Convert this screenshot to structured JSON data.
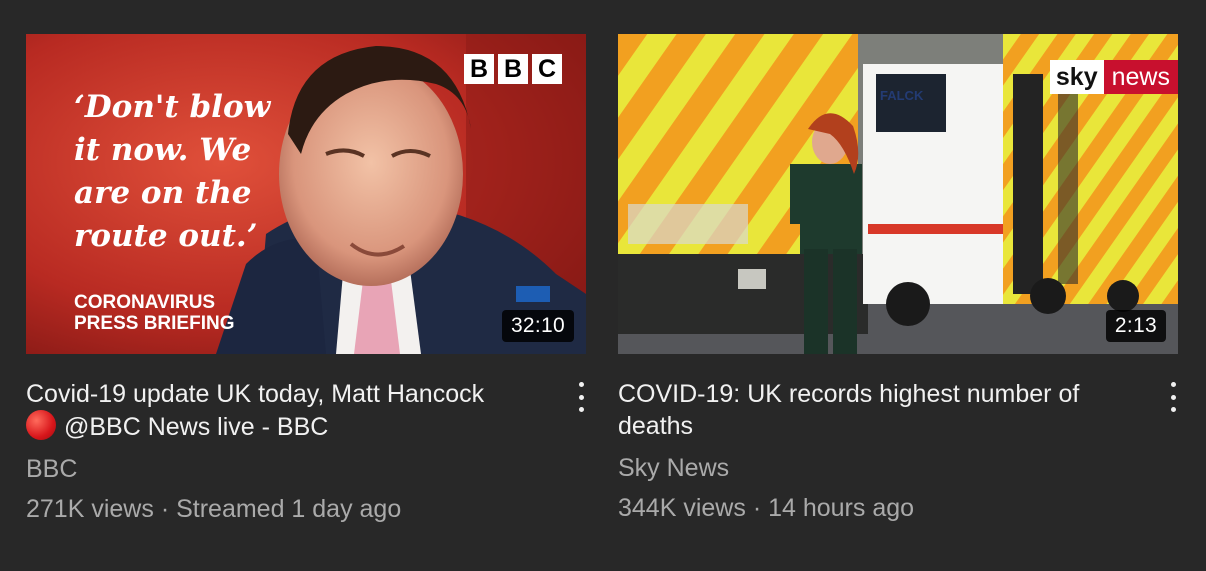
{
  "videos": [
    {
      "title": "Covid-19 update UK today, Matt Hancock",
      "title_line2": "@BBC News live - BBC",
      "channel": "BBC",
      "views": "271K views",
      "separator": "·",
      "age": "Streamed 1 day ago",
      "duration": "32:10",
      "thumb_quote": "‘Don't blow\nit now. We\nare on the\nroute out.’",
      "thumb_briefing_line1": "CORONAVIRUS",
      "thumb_briefing_line2": "PRESS BRIEFING",
      "thumb_logo": [
        "B",
        "B",
        "C"
      ],
      "menu_icon": "more-vert-icon"
    },
    {
      "title": "COVID-19: UK records highest number of deaths",
      "channel": "Sky News",
      "views": "344K views",
      "separator": "·",
      "age": "14 hours ago",
      "duration": "2:13",
      "thumb_logo_sky": "sky",
      "thumb_logo_news": "news",
      "menu_icon": "more-vert-icon"
    }
  ],
  "colors": {
    "background": "#282828",
    "title_text": "#f1f1f1",
    "secondary_text": "#aaaaaa",
    "live_dot": "#d8161b",
    "sky_red": "#c8102e"
  }
}
